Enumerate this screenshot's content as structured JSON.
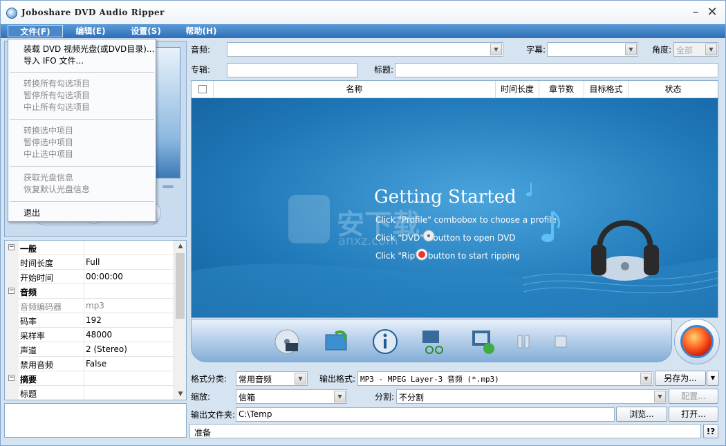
{
  "window": {
    "title": "Joboshare DVD Audio Ripper",
    "minimize_glyph": "–",
    "close_glyph": "✕"
  },
  "menubar": [
    {
      "label": "文件(F)"
    },
    {
      "label": "编辑(E)"
    },
    {
      "label": "设置(S)"
    },
    {
      "label": "帮助(H)"
    }
  ],
  "file_menu": {
    "load_disc": "装载 DVD 视频光盘(或DVD目录)...",
    "import_ifo": "导入 IFO 文件...",
    "convert_all_checked": "转换所有勾选项目",
    "pause_all_checked": "暂停所有勾选项目",
    "stop_all_checked": "中止所有勾选项目",
    "convert_selected": "转换选中项目",
    "pause_selected": "暂停选中项目",
    "stop_selected": "中止选中项目",
    "get_disc_info": "获取光盘信息",
    "restore_disc_info": "恢复默认光盘信息",
    "exit": "退出"
  },
  "fields": {
    "audio_label": "音频:",
    "audio_value": "",
    "subtitle_label": "字幕:",
    "subtitle_value": "",
    "angle_label": "角度:",
    "angle_value": "全部",
    "album_label": "专辑:",
    "album_value": "",
    "title_label": "标题:",
    "title_value": ""
  },
  "list": {
    "columns": [
      "名称",
      "时间长度",
      "章节数",
      "目标格式",
      "状态"
    ]
  },
  "getting_started": {
    "title": "Getting Started",
    "line1": "Click \"Profile\" combobox to choose a profile",
    "line2": "Click \"DVD\"       \" button to open DVD",
    "line3": "Click \"Rip\"       \" button to start ripping",
    "watermark": "安下载",
    "watermark_url": "anxz.com"
  },
  "properties": [
    {
      "type": "cat",
      "key": "一般",
      "value": ""
    },
    {
      "type": "row",
      "key": "时间长度",
      "value": "Full"
    },
    {
      "type": "row",
      "key": "开始时间",
      "value": "00:00:00"
    },
    {
      "type": "cat",
      "key": "音频",
      "value": ""
    },
    {
      "type": "dim",
      "key": "音频编码器",
      "value": "mp3"
    },
    {
      "type": "row",
      "key": "码率",
      "value": "192"
    },
    {
      "type": "row",
      "key": "采样率",
      "value": "48000"
    },
    {
      "type": "row",
      "key": "声道",
      "value": "2 (Stereo)"
    },
    {
      "type": "row",
      "key": "禁用音频",
      "value": "False"
    },
    {
      "type": "cat",
      "key": "摘要",
      "value": ""
    },
    {
      "type": "row",
      "key": "标题",
      "value": ""
    }
  ],
  "settings": {
    "format_category_label": "格式分类:",
    "format_category_value": "常用音频",
    "output_format_label": "输出格式:",
    "output_format_value": "MP3 - MPEG Layer-3 音频  (*.mp3)",
    "save_as_label": "另存为...",
    "zoom_label": "缩放:",
    "zoom_value": "信箱",
    "split_label": "分割:",
    "split_value": "不分割",
    "config_label": "配置...",
    "output_folder_label": "输出文件夹:",
    "output_folder_value": "C:\\Temp",
    "browse_label": "浏览...",
    "open_label": "打开...",
    "help_label": "!?"
  },
  "status": "准备",
  "colors": {
    "menubar": "#2e6fb7",
    "stage": "#1f78b8",
    "rip_button": "#ff5a1f"
  },
  "icons": {
    "toolbar": [
      "dvd-open-icon",
      "load-folder-icon",
      "info-icon",
      "clip-icon",
      "snapshot-icon",
      "pause-icon",
      "stop-icon"
    ],
    "rip": "rip-icon"
  }
}
